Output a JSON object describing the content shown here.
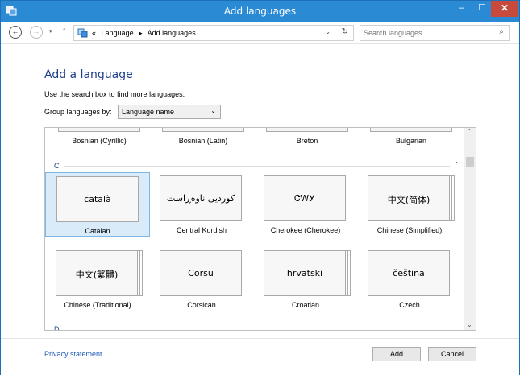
{
  "window": {
    "title": "Add languages",
    "min": "–",
    "max": "☐",
    "close": "✕"
  },
  "nav": {
    "back": "←",
    "forward": "→",
    "dropdown": "▾",
    "up": "↑",
    "breadcrumbs": [
      "«",
      "Language",
      "▸",
      "Add languages"
    ],
    "address_dropdown": "⌄",
    "refresh": "↻",
    "search_placeholder": "Search languages",
    "search_icon": "⌕"
  },
  "main": {
    "heading": "Add a language",
    "hint": "Use the search box to find more languages.",
    "group_label": "Group languages by:",
    "group_value": "Language name",
    "group_chevron": "⌄"
  },
  "list": {
    "top_row": [
      "Bosnian (Cyrillic)",
      "Bosnian (Latin)",
      "Breton",
      "Bulgarian"
    ],
    "section_letter": "C",
    "collapse_glyph": "⌃",
    "tiles": [
      {
        "native": "català",
        "name": "Catalan"
      },
      {
        "native": "کوردیی ناوەڕاست",
        "name": "Central Kurdish"
      },
      {
        "native": "ᏣᎳᎩ",
        "name": "Cherokee (Cherokee)"
      },
      {
        "native": "中文(简体)",
        "name": "Chinese (Simplified)"
      },
      {
        "native": "中文(繁體)",
        "name": "Chinese (Traditional)"
      },
      {
        "native": "Corsu",
        "name": "Corsican"
      },
      {
        "native": "hrvatski",
        "name": "Croatian"
      },
      {
        "native": "čeština",
        "name": "Czech"
      }
    ],
    "next_letter": "D",
    "scroll_up": "⌃",
    "scroll_down": "⌄"
  },
  "footer": {
    "privacy": "Privacy statement",
    "add": "Add",
    "cancel": "Cancel"
  },
  "colors": {
    "titlebar": "#2a8ad4",
    "close": "#c74a3c",
    "accent": "#1e3f8a",
    "selected": "#d9ebf9"
  }
}
